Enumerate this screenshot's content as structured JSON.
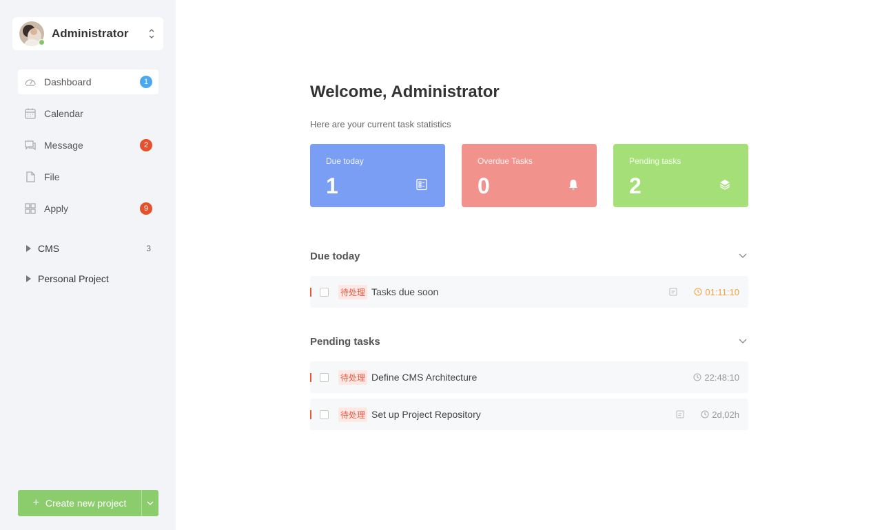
{
  "user": {
    "name": "Administrator"
  },
  "nav": [
    {
      "label": "Dashboard",
      "icon": "dashboard-icon",
      "badge": "1",
      "badge_color": "#4aa8ee",
      "active": true
    },
    {
      "label": "Calendar",
      "icon": "calendar-icon",
      "badge": null
    },
    {
      "label": "Message",
      "icon": "message-icon",
      "badge": "2",
      "badge_color": "#e5512c"
    },
    {
      "label": "File",
      "icon": "file-icon",
      "badge": null
    },
    {
      "label": "Apply",
      "icon": "apps-icon",
      "badge": "9",
      "badge_color": "#e5512c"
    }
  ],
  "projects": [
    {
      "label": "CMS",
      "count": "3"
    },
    {
      "label": "Personal Project",
      "count": ""
    }
  ],
  "create_button": {
    "label": "Create new project"
  },
  "main": {
    "welcome": "Welcome, Administrator",
    "subtitle": "Here are your current task statistics"
  },
  "stats": [
    {
      "label": "Due today",
      "value": "1",
      "color": "#7a9ef3",
      "icon": "checklist-icon"
    },
    {
      "label": "Overdue Tasks",
      "value": "0",
      "color": "#f1938c",
      "icon": "bell-icon"
    },
    {
      "label": "Pending tasks",
      "value": "2",
      "color": "#a4e077",
      "icon": "layers-icon"
    }
  ],
  "sections": [
    {
      "title": "Due today",
      "tasks": [
        {
          "tag": "待处理",
          "title": "Tasks due soon",
          "time": "01:11:10",
          "has_subtask": true,
          "urgent": true
        }
      ]
    },
    {
      "title": "Pending tasks",
      "tasks": [
        {
          "tag": "待处理",
          "title": "Define CMS Architecture",
          "time": "22:48:10",
          "has_subtask": false,
          "urgent": false
        },
        {
          "tag": "待处理",
          "title": "Set up Project Repository",
          "time": "2d,02h",
          "has_subtask": true,
          "urgent": false
        }
      ]
    }
  ]
}
